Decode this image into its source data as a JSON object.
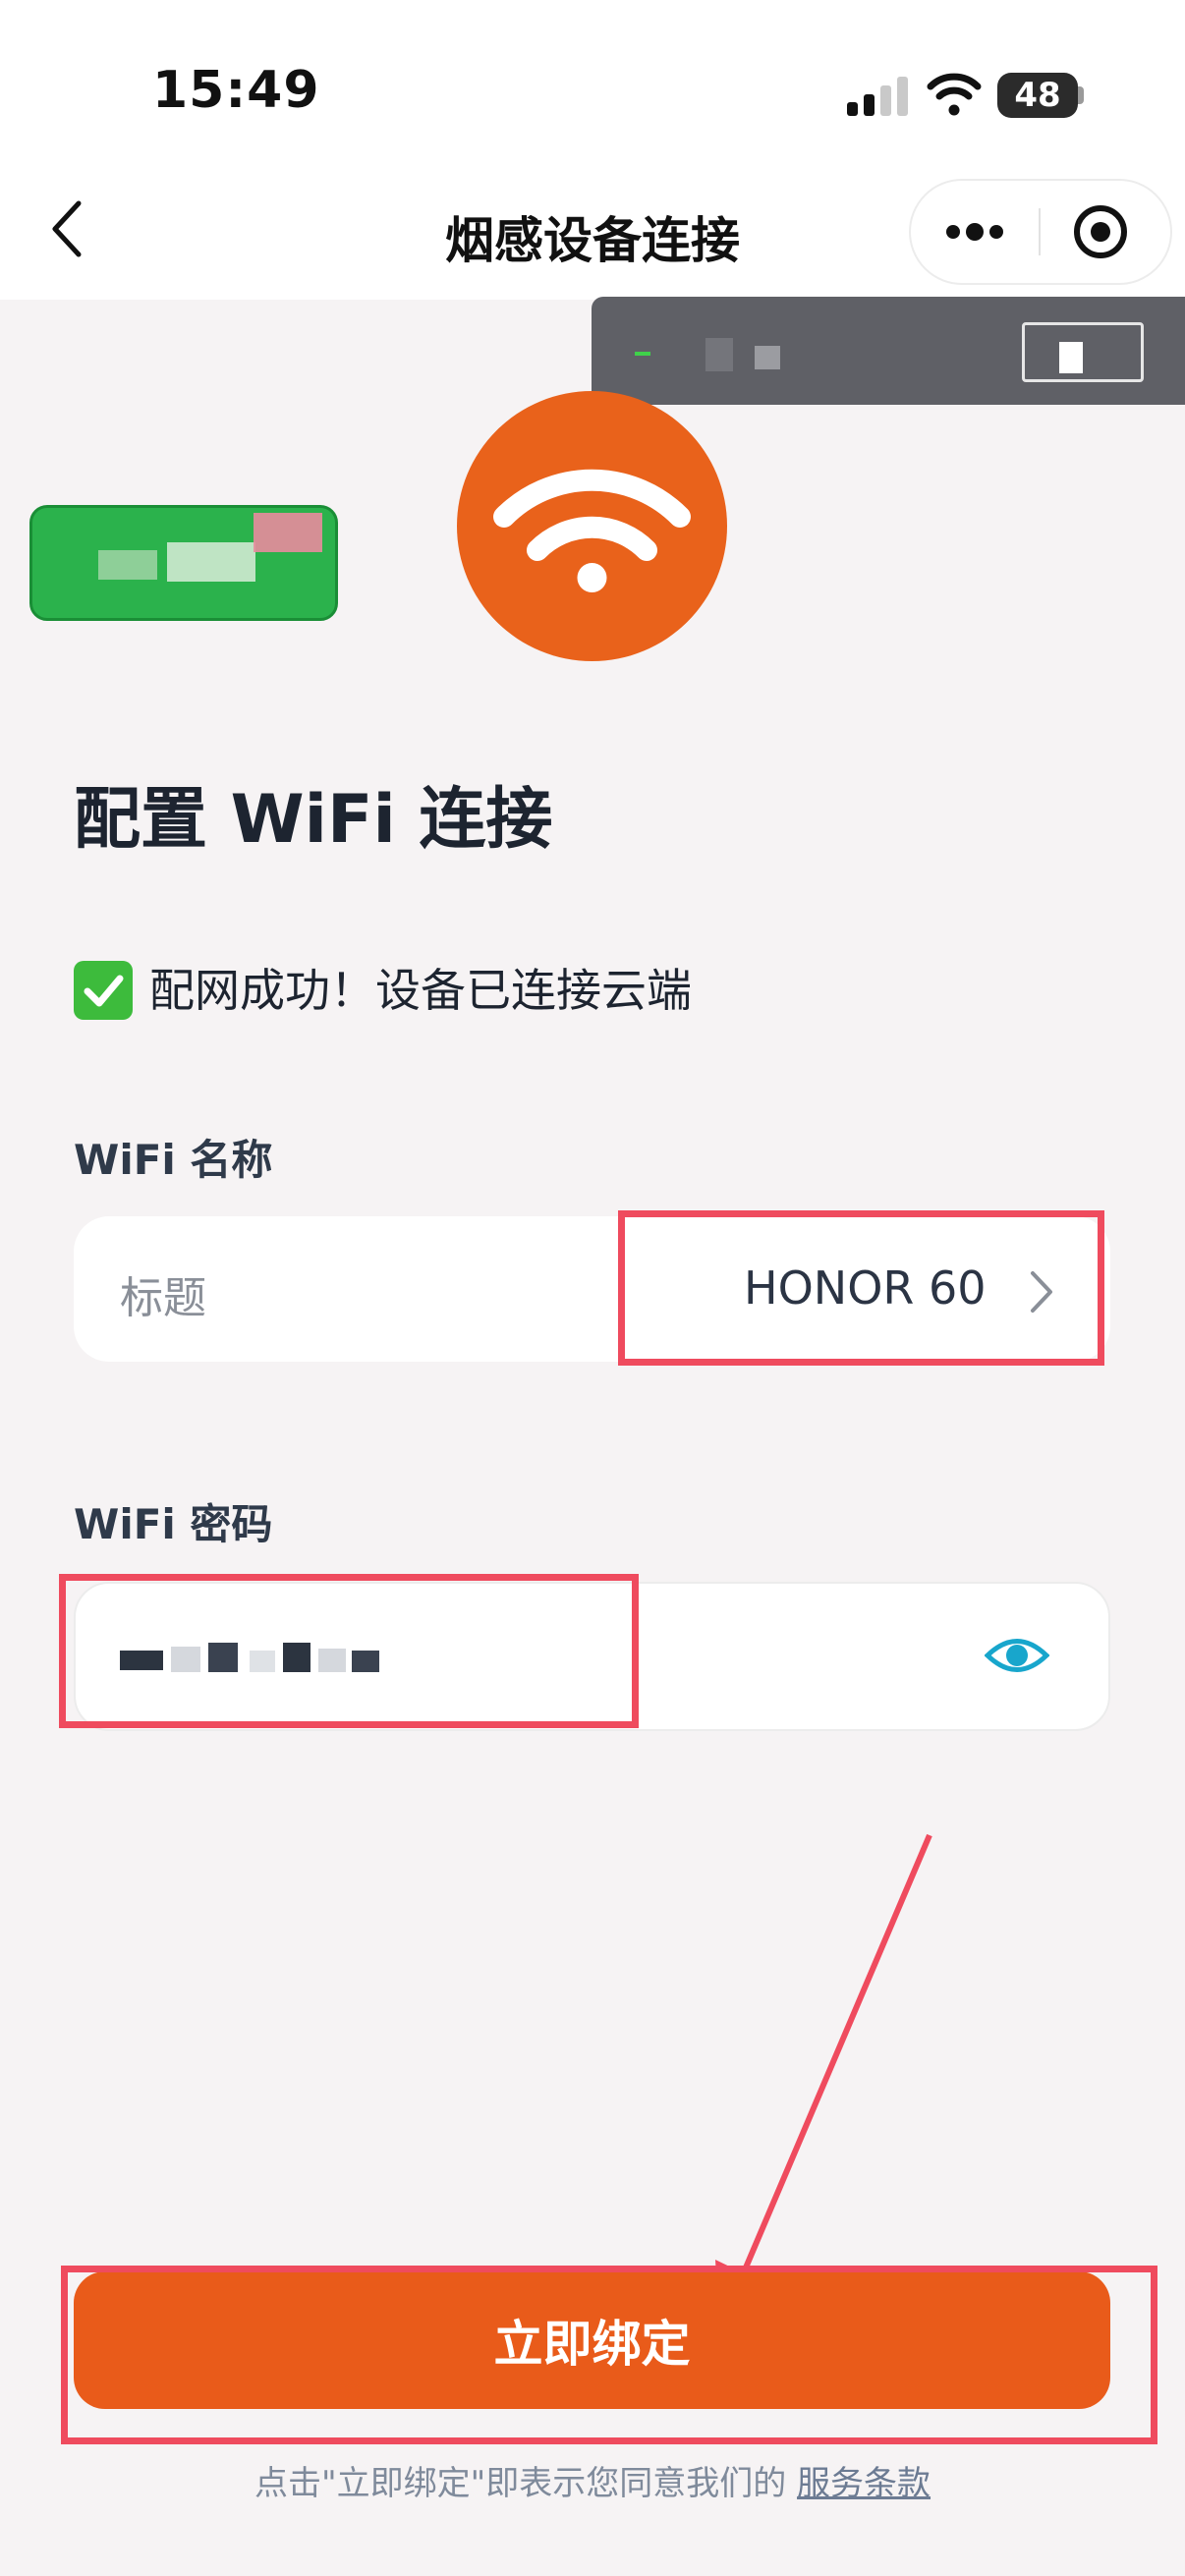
{
  "status_bar": {
    "time": "15:49",
    "battery": "48"
  },
  "nav": {
    "title": "烟感设备连接"
  },
  "brand": {
    "accent": "#e95b1a",
    "annotation": "#ef4b5e",
    "success": "#3dbb3c",
    "tag": "#2bb24c"
  },
  "config": {
    "heading": "配置 WiFi 连接",
    "success_message": "配网成功！设备已连接云端",
    "wifi_name_label": "WiFi 名称",
    "ssid_placeholder": "标题",
    "ssid_value": "HONOR 60",
    "wifi_password_label": "WiFi 密码"
  },
  "actions": {
    "bind_label": "立即绑定"
  },
  "footer": {
    "terms_prefix": "点击\"立即绑定\"即表示您同意我们的",
    "terms_link": "服务条款"
  },
  "icons": [
    "back-icon",
    "more-icon",
    "target-icon",
    "wifi-icon",
    "checkmark-icon",
    "chevron-right-icon",
    "eye-icon"
  ]
}
